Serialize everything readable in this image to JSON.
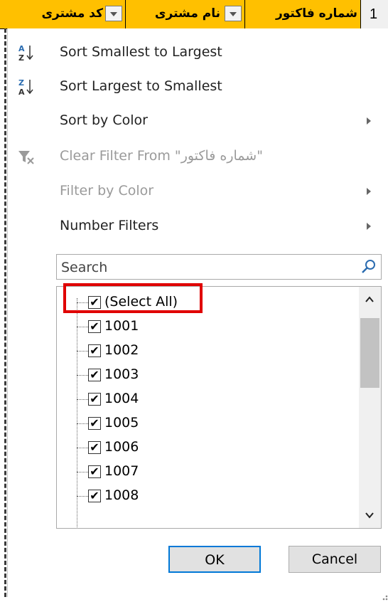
{
  "header": {
    "col1": "کد مشتری",
    "col2": "نام مشتری",
    "col3": "شماره فاکتور",
    "row_number": "1"
  },
  "menu": {
    "sort_asc": "Sort Smallest to Largest",
    "sort_desc": "Sort Largest to Smallest",
    "sort_color": "Sort by Color",
    "clear_filter": "Clear Filter From \"شماره فاکتور\"",
    "filter_color": "Filter by Color",
    "number_filters": "Number Filters"
  },
  "search": {
    "placeholder": "Search"
  },
  "list": {
    "items": [
      {
        "label": "(Select All)",
        "checked": true
      },
      {
        "label": "1001",
        "checked": true
      },
      {
        "label": "1002",
        "checked": true
      },
      {
        "label": "1003",
        "checked": true
      },
      {
        "label": "1004",
        "checked": true
      },
      {
        "label": "1005",
        "checked": true
      },
      {
        "label": "1006",
        "checked": true
      },
      {
        "label": "1007",
        "checked": true
      },
      {
        "label": "1008",
        "checked": true
      }
    ],
    "check_glyph": "✔"
  },
  "buttons": {
    "ok": "OK",
    "cancel": "Cancel"
  },
  "colors": {
    "header_bg": "#ffc000",
    "highlight": "#e00000",
    "ok_border": "#0078d7"
  },
  "icons": {
    "sort_asc": "sort-a-z-icon",
    "sort_desc": "sort-z-a-icon",
    "clear": "clear-filter-icon",
    "search": "magnifier-icon"
  }
}
